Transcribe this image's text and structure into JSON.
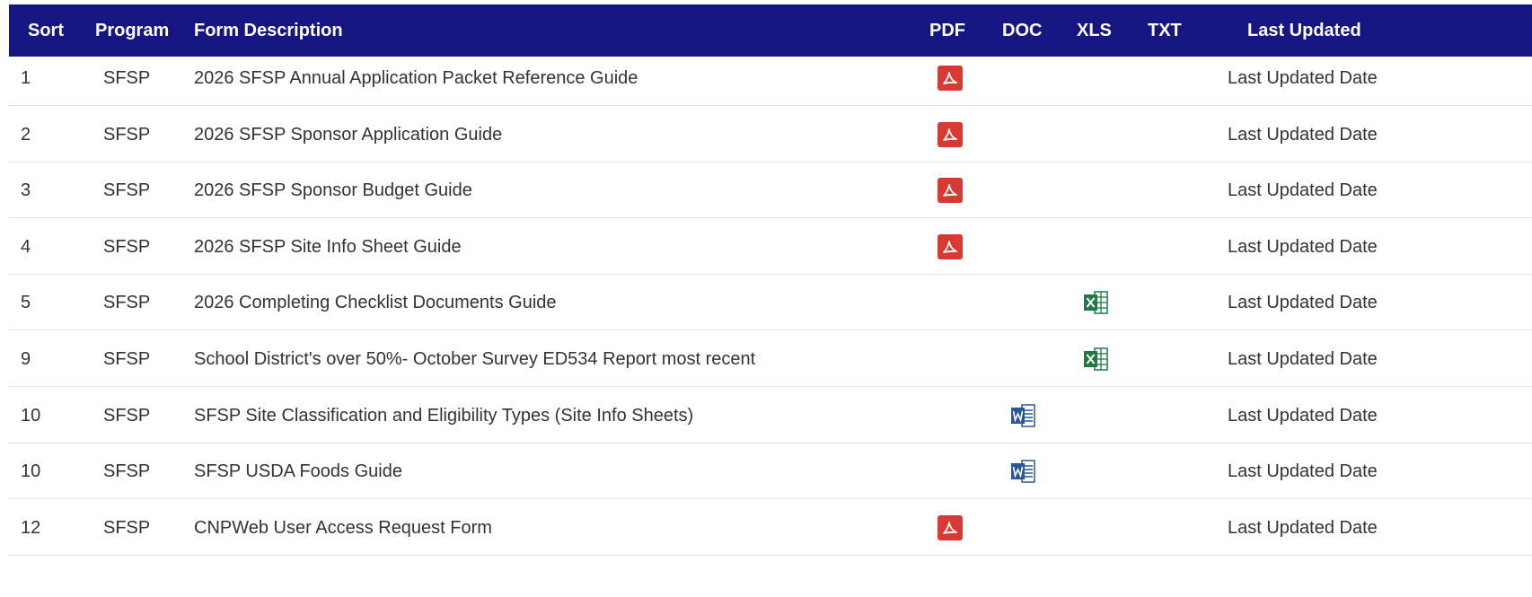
{
  "header": {
    "sort": "Sort",
    "program": "Program",
    "description": "Form Description",
    "pdf": "PDF",
    "doc": "DOC",
    "xls": "XLS",
    "txt": "TXT",
    "updated": "Last Updated"
  },
  "colors": {
    "header_bg": "#151682",
    "pdf_icon": "#d63a32",
    "doc_icon": "#2b5797",
    "xls_icon": "#1f7a46"
  },
  "rows": [
    {
      "sort": "1",
      "program": "SFSP",
      "description": "2026 SFSP Annual Application Packet Reference Guide",
      "file_type": "pdf",
      "icon": "pdf-file-icon",
      "updated": "Last Updated Date"
    },
    {
      "sort": "2",
      "program": "SFSP",
      "description": "2026 SFSP Sponsor Application Guide",
      "file_type": "pdf",
      "icon": "pdf-file-icon",
      "updated": "Last Updated Date"
    },
    {
      "sort": "3",
      "program": "SFSP",
      "description": "2026 SFSP Sponsor Budget Guide",
      "file_type": "pdf",
      "icon": "pdf-file-icon",
      "updated": "Last Updated Date"
    },
    {
      "sort": "4",
      "program": "SFSP",
      "description": "2026 SFSP Site Info Sheet Guide",
      "file_type": "pdf",
      "icon": "pdf-file-icon",
      "updated": "Last Updated Date"
    },
    {
      "sort": "5",
      "program": "SFSP",
      "description": "2026 Completing Checklist Documents Guide",
      "file_type": "xls",
      "icon": "excel-file-icon",
      "updated": "Last Updated Date"
    },
    {
      "sort": "9",
      "program": "SFSP",
      "description": "School District's over 50%- October Survey ED534 Report most recent",
      "file_type": "xls",
      "icon": "excel-file-icon",
      "updated": "Last Updated Date"
    },
    {
      "sort": "10",
      "program": "SFSP",
      "description": "SFSP Site Classification and Eligibility Types (Site Info Sheets)",
      "file_type": "doc",
      "icon": "word-file-icon",
      "updated": "Last Updated Date"
    },
    {
      "sort": "10",
      "program": "SFSP",
      "description": "SFSP USDA Foods Guide",
      "file_type": "doc",
      "icon": "word-file-icon",
      "updated": "Last Updated Date"
    },
    {
      "sort": "12",
      "program": "SFSP",
      "description": "CNPWeb User Access Request Form",
      "file_type": "pdf",
      "icon": "pdf-file-icon",
      "updated": "Last Updated Date"
    }
  ]
}
